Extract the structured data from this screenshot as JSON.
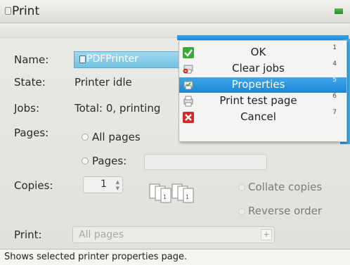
{
  "window": {
    "title": "Print"
  },
  "form": {
    "name_label": "Name:",
    "name_value": "PDFPrinter",
    "state_label": "State:",
    "state_value": "Printer idle",
    "jobs_label": "Jobs:",
    "jobs_value": "Total: 0, printing",
    "pages_label": "Pages:",
    "pages_all": "All pages",
    "pages_range": "Pages:",
    "pages_range_value": "",
    "copies_label": "Copies:",
    "copies_value": "1",
    "collate_label": "Collate copies",
    "reverse_label": "Reverse order",
    "print_label": "Print:",
    "print_value": "All pages"
  },
  "context_menu": {
    "items": [
      {
        "label": "OK",
        "key": "1",
        "icon": "check-icon",
        "selected": false
      },
      {
        "label": "Clear jobs",
        "key": "4",
        "icon": "clear-jobs-icon",
        "selected": false
      },
      {
        "label": "Properties",
        "key": "5",
        "icon": "properties-icon",
        "selected": true
      },
      {
        "label": "Print test page",
        "key": "6",
        "icon": "test-page-icon",
        "selected": false
      },
      {
        "label": "Cancel",
        "key": "7",
        "icon": "cancel-icon",
        "selected": false
      }
    ]
  },
  "statusbar": {
    "text": "Shows selected printer properties page."
  },
  "colors": {
    "accent": "#2e92dc",
    "ok_green": "#3aa83a",
    "cancel_red": "#d42a2a"
  }
}
